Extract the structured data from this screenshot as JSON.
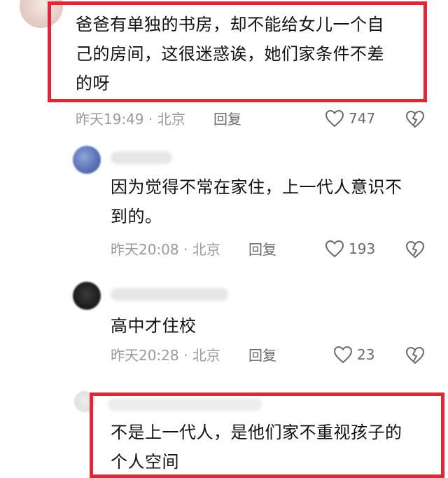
{
  "comments": [
    {
      "text_lines": [
        "爸爸有单独的书房，却不能给女儿一个自",
        "己的房间，这很迷惑诶，她们家条件不差",
        "的呀"
      ],
      "time": "昨天19:49",
      "location": "北京",
      "reply_label": "回复",
      "likes": "747"
    },
    {
      "text_lines": [
        "因为觉得不常在家住，上一代人意识不",
        "到的。"
      ],
      "time": "昨天20:08",
      "location": "北京",
      "reply_label": "回复",
      "likes": "193"
    },
    {
      "text_lines": [
        "高中才住校"
      ],
      "time": "昨天20:28",
      "location": "北京",
      "reply_label": "回复",
      "likes": "23"
    },
    {
      "text_lines": [
        "不是上一代人，是他们家不重视孩子的",
        "个人空间"
      ]
    }
  ],
  "separator": " · ",
  "icons": {
    "like": "heart-outline-icon",
    "dislike": "broken-heart-icon"
  },
  "colors": {
    "highlight": "#e0273a",
    "meta_text": "#9a9a9a",
    "body_text": "#111111"
  }
}
